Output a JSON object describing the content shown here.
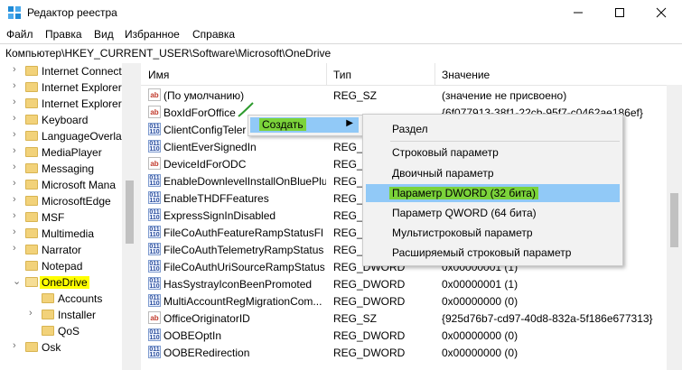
{
  "window": {
    "title": "Редактор реестра"
  },
  "menu": [
    "Файл",
    "Правка",
    "Вид",
    "Избранное",
    "Справка"
  ],
  "address": "Компьютер\\HKEY_CURRENT_USER\\Software\\Microsoft\\OneDrive",
  "tree": [
    {
      "label": "Internet Connect",
      "depth": 0,
      "expand": "›"
    },
    {
      "label": "Internet Explorer",
      "depth": 0,
      "expand": "›"
    },
    {
      "label": "Internet Explorer",
      "depth": 0,
      "expand": "›"
    },
    {
      "label": "Keyboard",
      "depth": 0,
      "expand": "›"
    },
    {
      "label": "LanguageOverla",
      "depth": 0,
      "expand": "›"
    },
    {
      "label": "MediaPlayer",
      "depth": 0,
      "expand": "›"
    },
    {
      "label": "Messaging",
      "depth": 0,
      "expand": "›"
    },
    {
      "label": "Microsoft Mana",
      "depth": 0,
      "expand": "›"
    },
    {
      "label": "MicrosoftEdge",
      "depth": 0,
      "expand": "›"
    },
    {
      "label": "MSF",
      "depth": 0,
      "expand": "›"
    },
    {
      "label": "Multimedia",
      "depth": 0,
      "expand": "›"
    },
    {
      "label": "Narrator",
      "depth": 0,
      "expand": "›"
    },
    {
      "label": "Notepad",
      "depth": 0,
      "expand": ""
    },
    {
      "label": "OneDrive",
      "depth": 0,
      "expand": "⌄",
      "selected": true
    },
    {
      "label": "Accounts",
      "depth": 1,
      "expand": ""
    },
    {
      "label": "Installer",
      "depth": 1,
      "expand": "›"
    },
    {
      "label": "QoS",
      "depth": 1,
      "expand": ""
    },
    {
      "label": "Osk",
      "depth": 0,
      "expand": "›"
    }
  ],
  "columns": {
    "name": "Имя",
    "type": "Тип",
    "value": "Значение"
  },
  "rows": [
    {
      "icon": "ab",
      "name": "(По умолчанию)",
      "type": "REG_SZ",
      "value": "(значение не присвоено)"
    },
    {
      "icon": "ab",
      "name": "BoxIdForOffice",
      "type": "",
      "value": "{6f077913-38f1-22cb-95f7-c0462ae186ef}"
    },
    {
      "icon": "bin",
      "name": "ClientConfigTeler",
      "type": "",
      "value": ""
    },
    {
      "icon": "bin",
      "name": "ClientEverSignedIn",
      "type": "REG_D",
      "value": ""
    },
    {
      "icon": "ab",
      "name": "DeviceIdForODC",
      "type": "REG_S",
      "value": "ef}"
    },
    {
      "icon": "bin",
      "name": "EnableDownlevelInstallOnBluePlus",
      "type": "REG_D",
      "value": ""
    },
    {
      "icon": "bin",
      "name": "EnableTHDFFeatures",
      "type": "REG_D",
      "value": ""
    },
    {
      "icon": "bin",
      "name": "ExpressSignInDisabled",
      "type": "REG_D",
      "value": ""
    },
    {
      "icon": "bin",
      "name": "FileCoAuthFeatureRampStatusFl",
      "type": "REG_D",
      "value": ""
    },
    {
      "icon": "bin",
      "name": "FileCoAuthTelemetryRampStatus",
      "type": "REG_D",
      "value": ""
    },
    {
      "icon": "bin",
      "name": "FileCoAuthUriSourceRampStatus",
      "type": "REG_DWORD",
      "value": "0x00000001 (1)"
    },
    {
      "icon": "bin",
      "name": "HasSystrayIconBeenPromoted",
      "type": "REG_DWORD",
      "value": "0x00000001 (1)"
    },
    {
      "icon": "bin",
      "name": "MultiAccountRegMigrationCom...",
      "type": "REG_DWORD",
      "value": "0x00000000 (0)"
    },
    {
      "icon": "ab",
      "name": "OfficeOriginatorID",
      "type": "REG_SZ",
      "value": "{925d76b7-cd97-40d8-832a-5f186e677313}"
    },
    {
      "icon": "bin",
      "name": "OOBEOptIn",
      "type": "REG_DWORD",
      "value": "0x00000000 (0)"
    },
    {
      "icon": "bin",
      "name": "OOBERedirection",
      "type": "REG_DWORD",
      "value": "0x00000000 (0)"
    }
  ],
  "context_menu": {
    "create": "Создать",
    "submenu": [
      "Раздел",
      "Строковый параметр",
      "Двоичный параметр",
      "Параметр DWORD (32 бита)",
      "Параметр QWORD (64 бита)",
      "Мультистроковый параметр",
      "Расширяемый строковый параметр"
    ],
    "highlighted_index": 3
  },
  "colors": {
    "menu_highlight": "#91c9f7",
    "marker_green": "#7bd33a",
    "selection_yellow": "#ffff00"
  }
}
